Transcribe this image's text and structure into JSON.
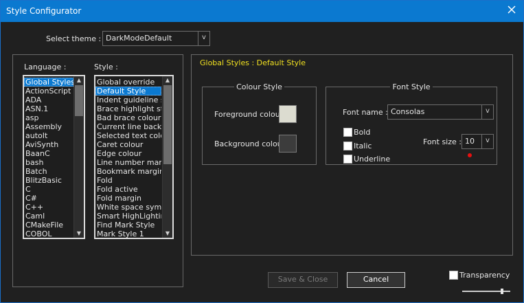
{
  "window": {
    "title": "Style Configurator"
  },
  "theme": {
    "label": "Select theme :",
    "value": "DarkModeDefault",
    "arrow": "v"
  },
  "language": {
    "label": "Language :",
    "items": [
      "Global Styles",
      "ActionScript",
      "ADA",
      "ASN.1",
      "asp",
      "Assembly",
      "autoIt",
      "AviSynth",
      "BaanC",
      "bash",
      "Batch",
      "BlitzBasic",
      "C",
      "C#",
      "C++",
      "Caml",
      "CMakeFile",
      "COBOL"
    ],
    "selected_index": 0
  },
  "style": {
    "label": "Style :",
    "items": [
      "Global override",
      "Default Style",
      "Indent guideline sty",
      "Brace highlight style",
      "Bad brace colour",
      "Current line backgr",
      "Selected text colou",
      "Caret colour",
      "Edge colour",
      "Line number margin",
      "Bookmark margin",
      "Fold",
      "Fold active",
      "Fold margin",
      "White space symbo",
      "Smart HighLighting",
      "Find Mark Style",
      "Mark Style 1"
    ],
    "selected_index": 1
  },
  "detail": {
    "heading": "Global Styles : Default Style",
    "heading_color": "#f0e020",
    "colour_style": {
      "legend": "Colour Style",
      "foreground_label": "Foreground colour",
      "foreground_color": "#dcdcd0",
      "background_label": "Background colour",
      "background_color": "#3c3c3c"
    },
    "font_style": {
      "legend": "Font Style",
      "font_name_label": "Font name :",
      "font_name": "Consolas",
      "bold_label": "Bold",
      "italic_label": "Italic",
      "underline_label": "Underline",
      "font_size_label": "Font size :",
      "font_size": "10",
      "arrow": "v"
    }
  },
  "buttons": {
    "save_close": "Save & Close",
    "cancel": "Cancel"
  },
  "transparency": {
    "label": "Transparency",
    "checked": false,
    "slider_value": 0.85
  },
  "icons": {
    "close": "close-icon",
    "dropdown": "chevron-down-icon",
    "indicator": "red-dot-icon"
  },
  "colors": {
    "titlebar": "#0b79d0",
    "selection": "#0b79d0",
    "indicator": "#e81010"
  }
}
